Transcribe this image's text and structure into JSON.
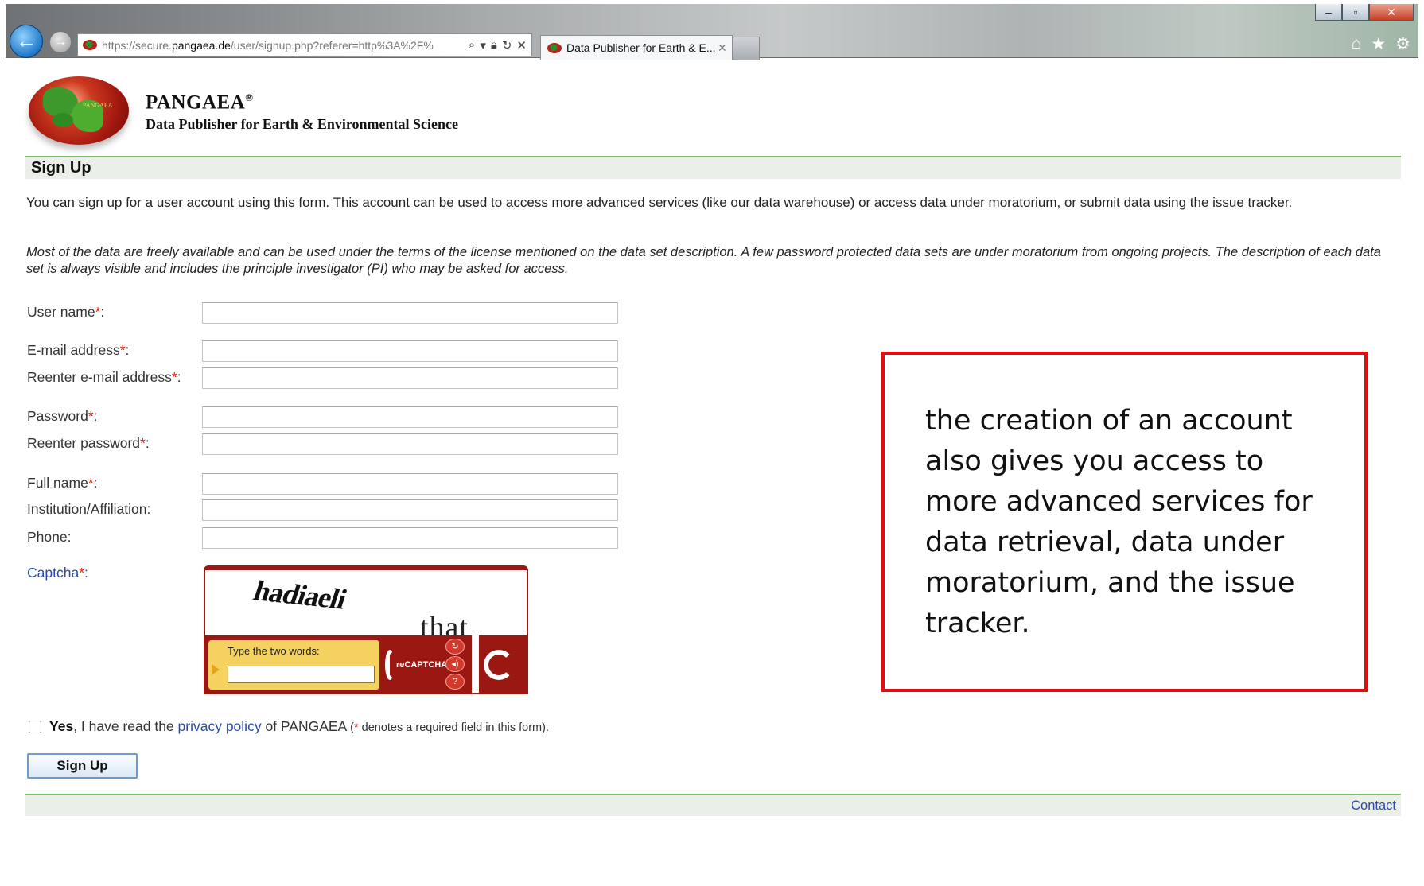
{
  "browser": {
    "url_prefix": "https://secure.",
    "url_domain": "pangaea.de",
    "url_path": "/user/signup.php?referer=http%3A%2F%",
    "tab_title": "Data Publisher for Earth & E...",
    "window_buttons": [
      "–",
      "▫",
      "✕"
    ],
    "icons": [
      "back-arrow-icon",
      "forward-arrow-icon",
      "search-icon",
      "lock-icon",
      "refresh-icon",
      "stop-icon",
      "home-icon",
      "star-icon",
      "gear-icon"
    ]
  },
  "header": {
    "brand": "PANGAEA",
    "registered_mark": "®",
    "tagline": "Data Publisher for Earth & Environmental Science",
    "logo_text": "PANGAEA"
  },
  "page": {
    "section_title": "Sign Up",
    "intro": "You can sign up for a user account using this form. This account can be used to access more advanced services (like our data warehouse) or access data under moratorium, or submit data using the issue tracker.",
    "note": "Most of the data are freely available and can be used under the terms of the license mentioned on the data set description. A few password protected data sets are under moratorium from ongoing projects. The description of each data set is always visible and includes the principle investigator (PI) who may be asked for access."
  },
  "form": {
    "required_mark": "*",
    "fields": [
      {
        "label": "User name",
        "required": true,
        "value": ""
      },
      {
        "label": "E-mail address",
        "required": true,
        "value": ""
      },
      {
        "label": "Reenter e-mail address",
        "required": true,
        "value": ""
      },
      {
        "label": "Password",
        "required": true,
        "value": ""
      },
      {
        "label": "Reenter password",
        "required": true,
        "value": ""
      },
      {
        "label": "Full name",
        "required": true,
        "value": ""
      },
      {
        "label": "Institution/Affiliation",
        "required": false,
        "value": ""
      },
      {
        "label": "Phone",
        "required": false,
        "value": ""
      }
    ],
    "captcha_label": "Captcha",
    "captcha": {
      "word1": "hadiaeli",
      "word2": "that",
      "prompt": "Type the two words:",
      "logo_text": "reCAPTCHA",
      "controls": [
        "↻",
        "◂)",
        "?"
      ]
    },
    "agree": {
      "yes": "Yes",
      "text_before_link": ", I have read the ",
      "link": "privacy policy",
      "text_after_link": " of PANGAEA ",
      "note_open": "(",
      "note_text": " denotes a required field in this form)."
    },
    "submit_label": "Sign Up"
  },
  "footer": {
    "contact": "Contact"
  },
  "callout": {
    "text": "the creation of an account also gives you access to more advanced services for data retrieval, data under moratorium, and the issue tracker.",
    "border_color": "#e01010"
  }
}
